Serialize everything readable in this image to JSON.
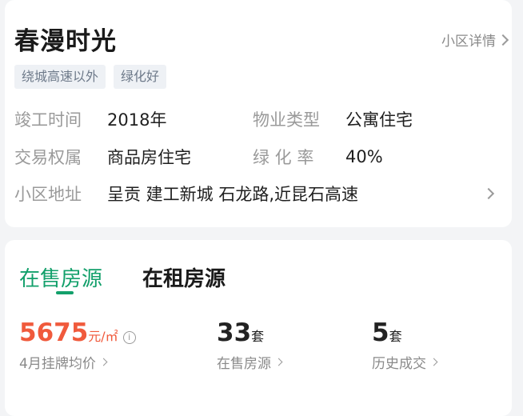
{
  "community": {
    "name": "春漫时光",
    "detail_link": "小区详情",
    "tags": [
      "绕城高速以外",
      "绿化好"
    ],
    "info": {
      "completion_label": "竣工时间",
      "completion_value": "2018年",
      "property_type_label": "物业类型",
      "property_type_value": "公寓住宅",
      "ownership_label": "交易权属",
      "ownership_value": "商品房住宅",
      "greening_label": "绿 化 率",
      "greening_value": "40%",
      "address_label": "小区地址",
      "address_value": "呈贡 建工新城 石龙路,近昆石高速"
    }
  },
  "listing": {
    "tabs": [
      "在售房源",
      "在租房源"
    ],
    "active_tab": "在售房源",
    "price_value": "5675",
    "price_unit": "元/㎡",
    "price_caption": "4月挂牌均价",
    "on_sale_count": "33",
    "on_sale_unit": "套",
    "on_sale_caption": "在售房源",
    "history_count": "5",
    "history_unit": "套",
    "history_caption": "历史成交"
  },
  "colors": {
    "accent_green": "#13a06b",
    "price_red": "#f05a3c"
  }
}
